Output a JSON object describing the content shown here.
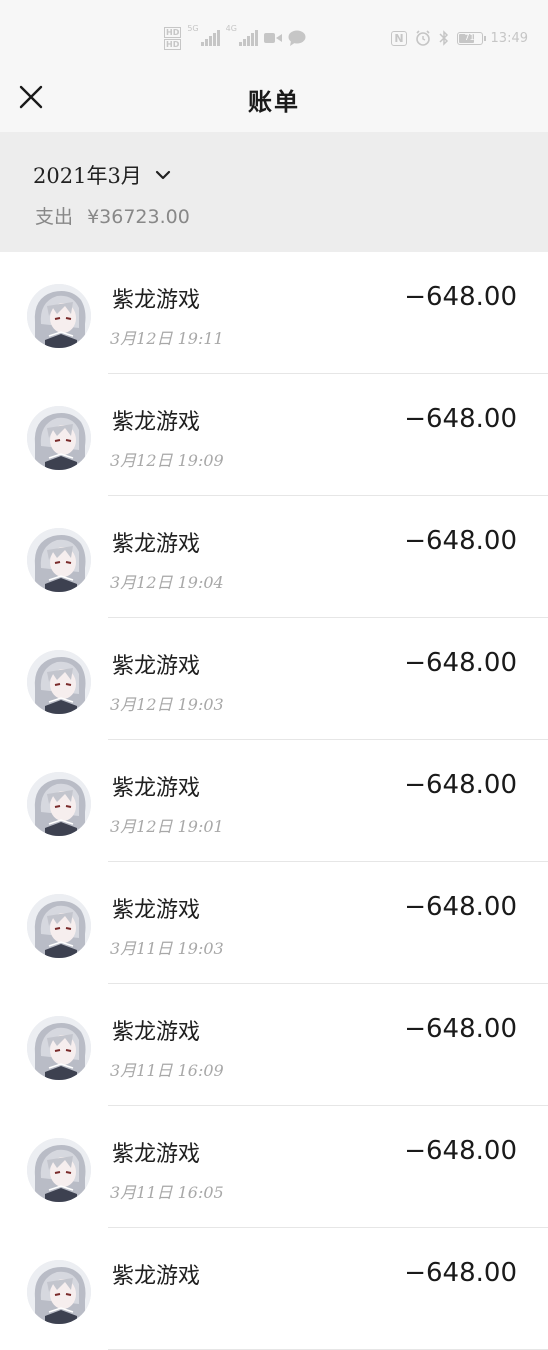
{
  "status_bar": {
    "hd1": "HD",
    "hd2": "HD",
    "net1": "5G",
    "net2": "4G",
    "nfc": "N",
    "battery_level": "71",
    "battery_fraction": 0.71,
    "time": "13:49"
  },
  "nav": {
    "title": "账单"
  },
  "summary": {
    "month": "2021年3月",
    "expense_label": "支出",
    "expense_value": "¥36723.00"
  },
  "transactions": [
    {
      "merchant": "紫龙游戏",
      "time": "3月12日 19:11",
      "amount": "−648.00"
    },
    {
      "merchant": "紫龙游戏",
      "time": "3月12日 19:09",
      "amount": "−648.00"
    },
    {
      "merchant": "紫龙游戏",
      "time": "3月12日 19:04",
      "amount": "−648.00"
    },
    {
      "merchant": "紫龙游戏",
      "time": "3月12日 19:03",
      "amount": "−648.00"
    },
    {
      "merchant": "紫龙游戏",
      "time": "3月12日 19:01",
      "amount": "−648.00"
    },
    {
      "merchant": "紫龙游戏",
      "time": "3月11日 19:03",
      "amount": "−648.00"
    },
    {
      "merchant": "紫龙游戏",
      "time": "3月11日 16:09",
      "amount": "−648.00"
    },
    {
      "merchant": "紫龙游戏",
      "time": "3月11日 16:05",
      "amount": "−648.00"
    },
    {
      "merchant": "紫龙游戏",
      "time": "",
      "amount": "−648.00"
    }
  ]
}
